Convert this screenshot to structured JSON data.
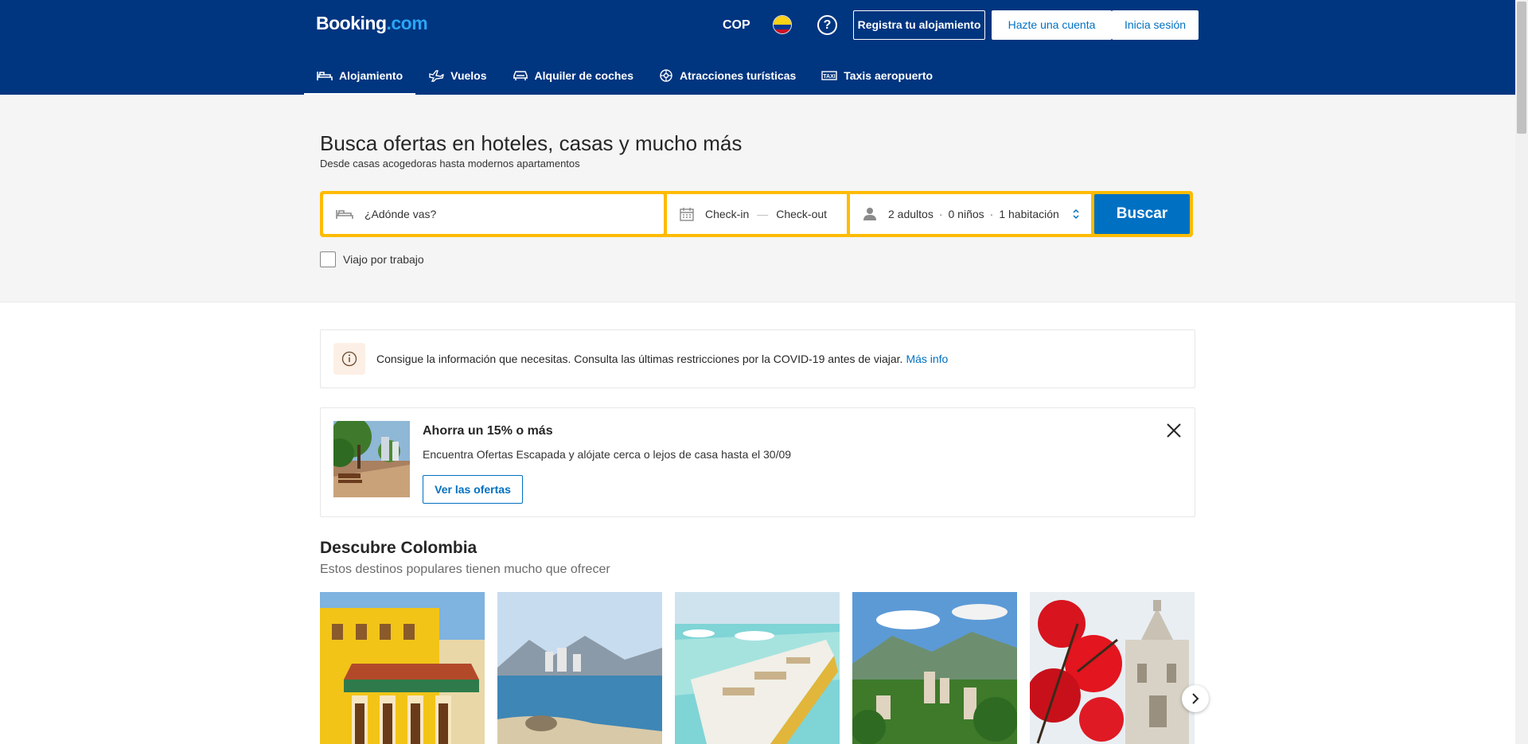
{
  "header": {
    "logo_main": "Booking",
    "logo_suffix": ".com",
    "currency": "COP",
    "help_label": "?",
    "register_property": "Registra tu alojamiento",
    "signup": "Hazte una cuenta",
    "signin": "Inicia sesión",
    "flag": "colombia-flag"
  },
  "nav": [
    {
      "label": "Alojamiento",
      "icon": "bed-icon",
      "active": true
    },
    {
      "label": "Vuelos",
      "icon": "plane-icon"
    },
    {
      "label": "Alquiler de coches",
      "icon": "car-icon"
    },
    {
      "label": "Atracciones turísticas",
      "icon": "attractions-icon"
    },
    {
      "label": "Taxis aeropuerto",
      "icon": "taxi-icon"
    }
  ],
  "hero": {
    "title": "Busca ofertas en hoteles, casas y mucho más",
    "subtitle": "Desde casas acogedoras hasta modernos apartamentos"
  },
  "search": {
    "destination_placeholder": "¿Adónde vas?",
    "checkin": "Check-in",
    "checkout": "Check-out",
    "adults": "2 adultos",
    "children": "0 niños",
    "rooms": "1 habitación",
    "button": "Buscar",
    "business_trip": "Viajo por trabajo",
    "accent_color": "#febb02"
  },
  "notice": {
    "text": "Consigue la información que necesitas. Consulta las últimas restricciones por la COVID-19 antes de viajar.",
    "link": "Más info"
  },
  "promo": {
    "title": "Ahorra un 15% o más",
    "text": "Encuentra Ofertas Escapada y alójate cerca o lejos de casa hasta el 30/09",
    "button": "Ver las ofertas"
  },
  "discover": {
    "title": "Descubre Colombia",
    "subtitle": "Estos destinos populares tienen mucho que ofrecer"
  },
  "colors": {
    "brand": "#003580",
    "primary_button": "#0071c2",
    "search_border": "#febb02"
  }
}
